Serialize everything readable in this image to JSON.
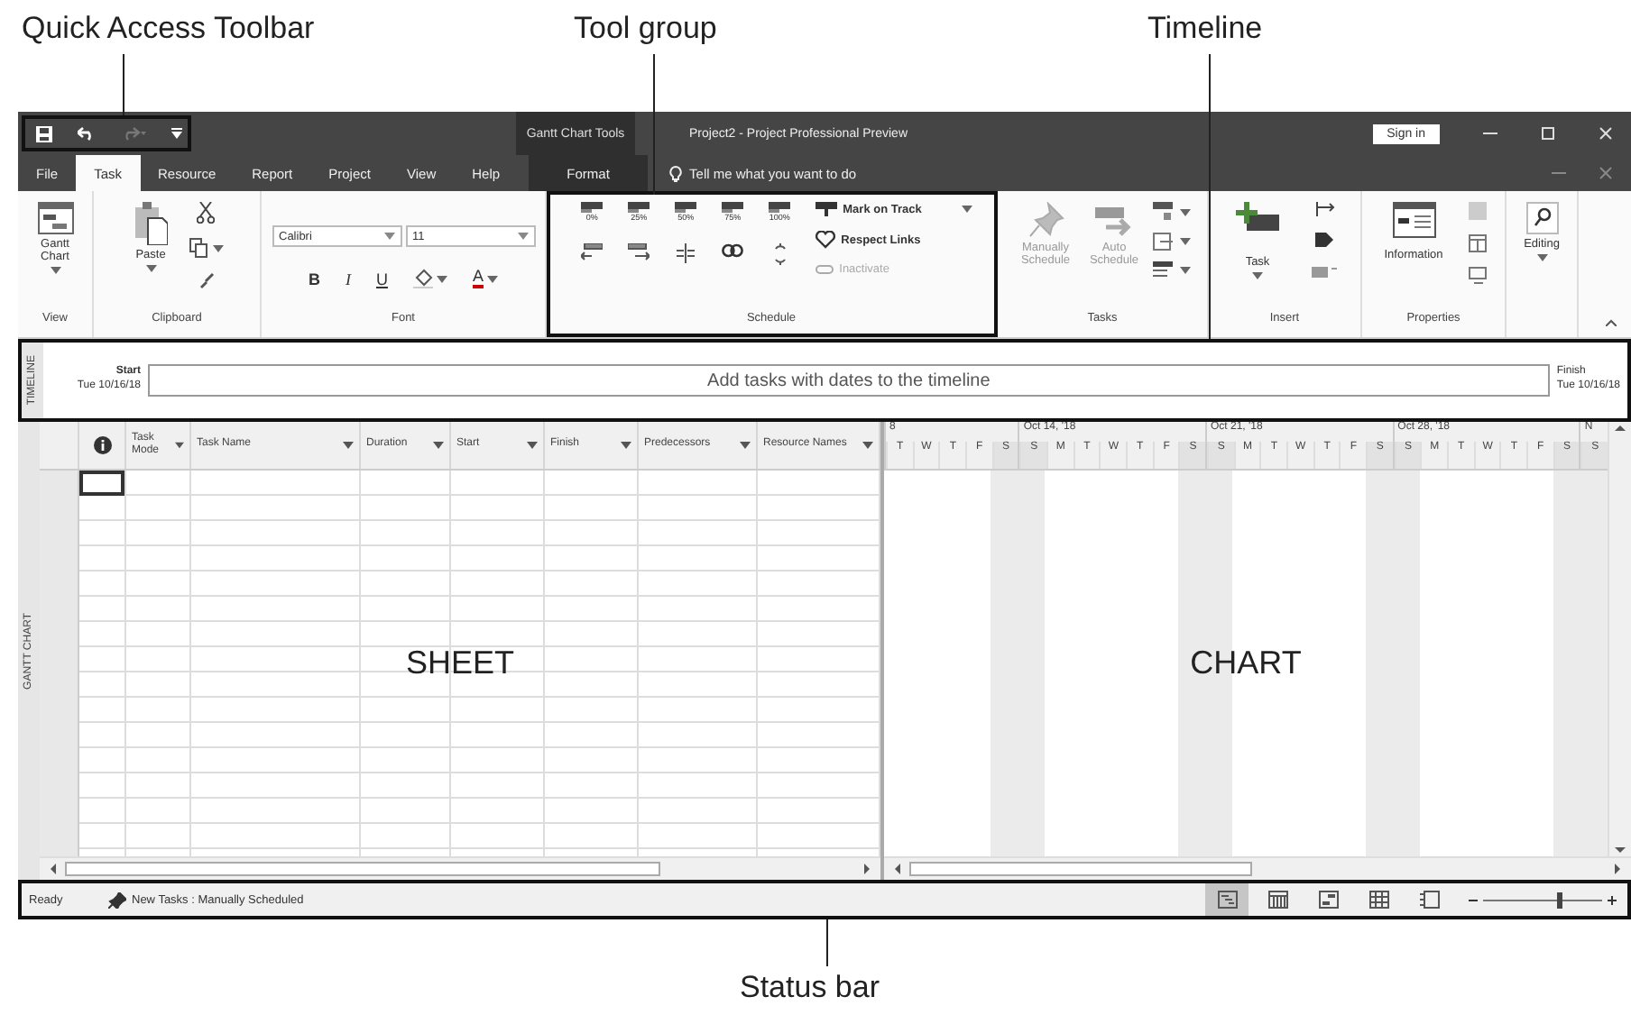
{
  "annotations": {
    "quick_access_label": "Quick Access Toolbar",
    "tool_group_label": "Tool group",
    "timeline_label": "Timeline",
    "status_bar_label": "Status bar",
    "sheet_label": "SHEET",
    "chart_label": "CHART"
  },
  "quick_access": [
    {
      "kind": "save",
      "disabled": false
    },
    {
      "kind": "undo",
      "disabled": false
    },
    {
      "kind": "redo",
      "disabled": true
    },
    {
      "kind": "customize",
      "disabled": false
    }
  ],
  "title_bar": {
    "contextual_label": "Gantt Chart Tools",
    "title": "Project2 - Project Professional Preview",
    "sign_in": "Sign in"
  },
  "tabs": [
    {
      "label": "File",
      "selected": false,
      "kind": "normal"
    },
    {
      "label": "Task",
      "selected": true,
      "kind": "normal"
    },
    {
      "label": "Resource",
      "selected": false,
      "kind": "normal"
    },
    {
      "label": "Report",
      "selected": false,
      "kind": "normal"
    },
    {
      "label": "Project",
      "selected": false,
      "kind": "normal"
    },
    {
      "label": "View",
      "selected": false,
      "kind": "normal"
    },
    {
      "label": "Help",
      "selected": false,
      "kind": "normal"
    },
    {
      "label": "Format",
      "selected": false,
      "kind": "contextual"
    }
  ],
  "tell_me": "Tell me what you want to do",
  "ribbon": {
    "view": {
      "label": "View",
      "gantt_button": "Gantt Chart"
    },
    "clipboard": {
      "label": "Clipboard",
      "paste": "Paste"
    },
    "font": {
      "label": "Font",
      "font_name": "Calibri",
      "font_size": "11",
      "bold": "B",
      "italic": "I",
      "underline": "U",
      "font_color": "A"
    },
    "schedule": {
      "label": "Schedule",
      "percent_buttons": [
        "0%",
        "25%",
        "50%",
        "75%",
        "100%"
      ],
      "mark_on_track": {
        "label": "Mark on Track",
        "disabled": false
      },
      "respect_links": {
        "label": "Respect Links",
        "disabled": false
      },
      "inactivate": {
        "label": "Inactivate",
        "disabled": true
      }
    },
    "tasks": {
      "label": "Tasks",
      "manually": {
        "label": "Manually Schedule",
        "disabled": true
      },
      "auto": {
        "label": "Auto Schedule",
        "disabled": true
      }
    },
    "insert": {
      "label": "Insert",
      "task": "Task"
    },
    "properties": {
      "label": "Properties",
      "information": "Information"
    },
    "editing": {
      "label": "Editing"
    }
  },
  "timeline": {
    "side_label": "TIMELINE",
    "start_label": "Start",
    "start_date": "Tue 10/16/18",
    "placeholder": "Add tasks with dates to the timeline",
    "finish_label": "Finish",
    "finish_date": "Tue 10/16/18"
  },
  "view_label": "GANTT CHART",
  "sheet": {
    "columns": [
      {
        "kind": "indicator"
      },
      {
        "kind": "field",
        "label": "Task Mode"
      },
      {
        "kind": "field",
        "label": "Task Name"
      },
      {
        "kind": "field",
        "label": "Duration"
      },
      {
        "kind": "field",
        "label": "Start"
      },
      {
        "kind": "field",
        "label": "Finish"
      },
      {
        "kind": "field",
        "label": "Predecessors"
      },
      {
        "kind": "field",
        "label": "Resource Names"
      }
    ]
  },
  "timescale": {
    "weeks": [
      {
        "label": "8",
        "days": [
          {
            "label": "T",
            "weekend": false
          },
          {
            "label": "W",
            "weekend": false
          },
          {
            "label": "T",
            "weekend": false
          },
          {
            "label": "F",
            "weekend": false
          },
          {
            "label": "S",
            "weekend": true
          }
        ]
      },
      {
        "label": "Oct 14, '18",
        "days": [
          {
            "label": "S",
            "weekend": true
          },
          {
            "label": "M",
            "weekend": false
          },
          {
            "label": "T",
            "weekend": false
          },
          {
            "label": "W",
            "weekend": false
          },
          {
            "label": "T",
            "weekend": false
          },
          {
            "label": "F",
            "weekend": false
          },
          {
            "label": "S",
            "weekend": true
          }
        ]
      },
      {
        "label": "Oct 21, '18",
        "days": [
          {
            "label": "S",
            "weekend": true
          },
          {
            "label": "M",
            "weekend": false
          },
          {
            "label": "T",
            "weekend": false
          },
          {
            "label": "W",
            "weekend": false
          },
          {
            "label": "T",
            "weekend": false
          },
          {
            "label": "F",
            "weekend": false
          },
          {
            "label": "S",
            "weekend": true
          }
        ]
      },
      {
        "label": "Oct 28, '18",
        "days": [
          {
            "label": "S",
            "weekend": true
          },
          {
            "label": "M",
            "weekend": false
          },
          {
            "label": "T",
            "weekend": false
          },
          {
            "label": "W",
            "weekend": false
          },
          {
            "label": "T",
            "weekend": false
          },
          {
            "label": "F",
            "weekend": false
          },
          {
            "label": "S",
            "weekend": true
          }
        ]
      },
      {
        "label": "N",
        "days": [
          {
            "label": "S",
            "weekend": true
          }
        ]
      }
    ]
  },
  "status_bar": {
    "ready": "Ready",
    "new_tasks": "New Tasks : Manually Scheduled",
    "views": [
      {
        "kind": "gantt",
        "selected": true
      },
      {
        "kind": "usage",
        "selected": false
      },
      {
        "kind": "planner",
        "selected": false
      },
      {
        "kind": "sheet",
        "selected": false
      },
      {
        "kind": "report",
        "selected": false
      }
    ],
    "zoom": {
      "level": 0.62
    }
  }
}
